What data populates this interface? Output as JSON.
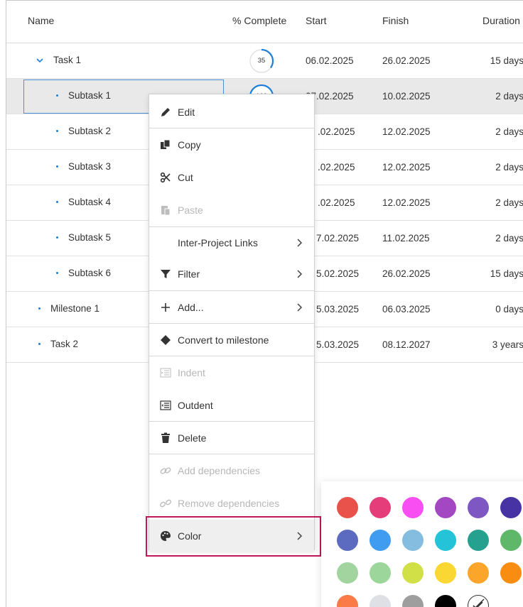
{
  "columns": {
    "name": "Name",
    "complete": "% Complete",
    "start": "Start",
    "finish": "Finish",
    "duration": "Duration"
  },
  "rows": [
    {
      "name": "Task 1",
      "complete": "35",
      "complete_value": 35,
      "start": "06.02.2025",
      "finish": "26.02.2025",
      "duration": "15 days",
      "type": "parent"
    },
    {
      "name": "Subtask 1",
      "complete": "100",
      "complete_value": 100,
      "start": "07.02.2025",
      "finish": "10.02.2025",
      "duration": "2 days",
      "type": "child",
      "selected": true
    },
    {
      "name": "Subtask 2",
      "start": ".02.2025",
      "finish": "12.02.2025",
      "duration": "2 days",
      "type": "child"
    },
    {
      "name": "Subtask 3",
      "start": ".02.2025",
      "finish": "12.02.2025",
      "duration": "2 days",
      "type": "child"
    },
    {
      "name": "Subtask 4",
      "start": ".02.2025",
      "finish": "12.02.2025",
      "duration": "2 days",
      "type": "child"
    },
    {
      "name": "Subtask 5",
      "start": "7.02.2025",
      "finish": "11.02.2025",
      "duration": "2 days",
      "type": "child"
    },
    {
      "name": "Subtask 6",
      "start": "5.02.2025",
      "finish": "26.02.2025",
      "duration": "15 days",
      "type": "child"
    },
    {
      "name": "Milestone 1",
      "start": "5.03.2025",
      "finish": "06.03.2025",
      "duration": "0 days",
      "type": "top"
    },
    {
      "name": "Task 2",
      "start": "5.03.2025",
      "finish": "08.12.2027",
      "duration": "3 years",
      "type": "top"
    }
  ],
  "menu": {
    "edit": "Edit",
    "copy": "Copy",
    "cut": "Cut",
    "paste": "Paste",
    "inter_project_links": "Inter-Project Links",
    "filter": "Filter",
    "add": "Add...",
    "convert_to_milestone": "Convert to milestone",
    "indent": "Indent",
    "outdent": "Outdent",
    "delete": "Delete",
    "add_dependencies": "Add dependencies",
    "remove_dependencies": "Remove dependencies",
    "color": "Color"
  },
  "palette": {
    "colors": [
      "#e8524a",
      "#e53c7a",
      "#f94ff2",
      "#a347c2",
      "#7e57c2",
      "#4733a3",
      "#5c6bc0",
      "#3f9cf0",
      "#85bde0",
      "#24c3d7",
      "#26a08f",
      "#5fb86a",
      "#a1d49f",
      "#9dd69a",
      "#d2e047",
      "#fbd733",
      "#fba62a",
      "#f98d11",
      "#fa7b48",
      "#dfe0e6",
      "#9e9e9e",
      "#000000"
    ],
    "no_color_icon": "no-color-icon"
  },
  "colors": {
    "accent": "#1e7fd9",
    "selection_border": "#4d8fd6",
    "highlight_border": "#c2185b"
  }
}
